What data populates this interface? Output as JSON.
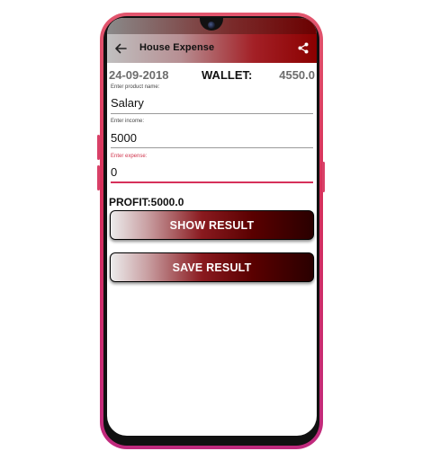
{
  "appbar": {
    "title": "House Expense",
    "back_icon": "arrow-left-icon",
    "share_icon": "share-icon"
  },
  "summary": {
    "date": "24-09-2018",
    "wallet_label": "WALLET:",
    "wallet_value": "4550.0"
  },
  "form": {
    "product": {
      "label": "Enter product name:",
      "value": "Salary"
    },
    "income": {
      "label": "Enter income:",
      "value": "5000"
    },
    "expense": {
      "label": "Enter expense:",
      "value": "0"
    }
  },
  "profit_text": "PROFIT:5000.0",
  "buttons": {
    "show_result": "SHOW RESULT",
    "save_result": "SAVE RESULT"
  },
  "colors": {
    "accent": "#d6305a",
    "button_dark": "#5a0000",
    "appbar_dark": "#8b0000"
  }
}
